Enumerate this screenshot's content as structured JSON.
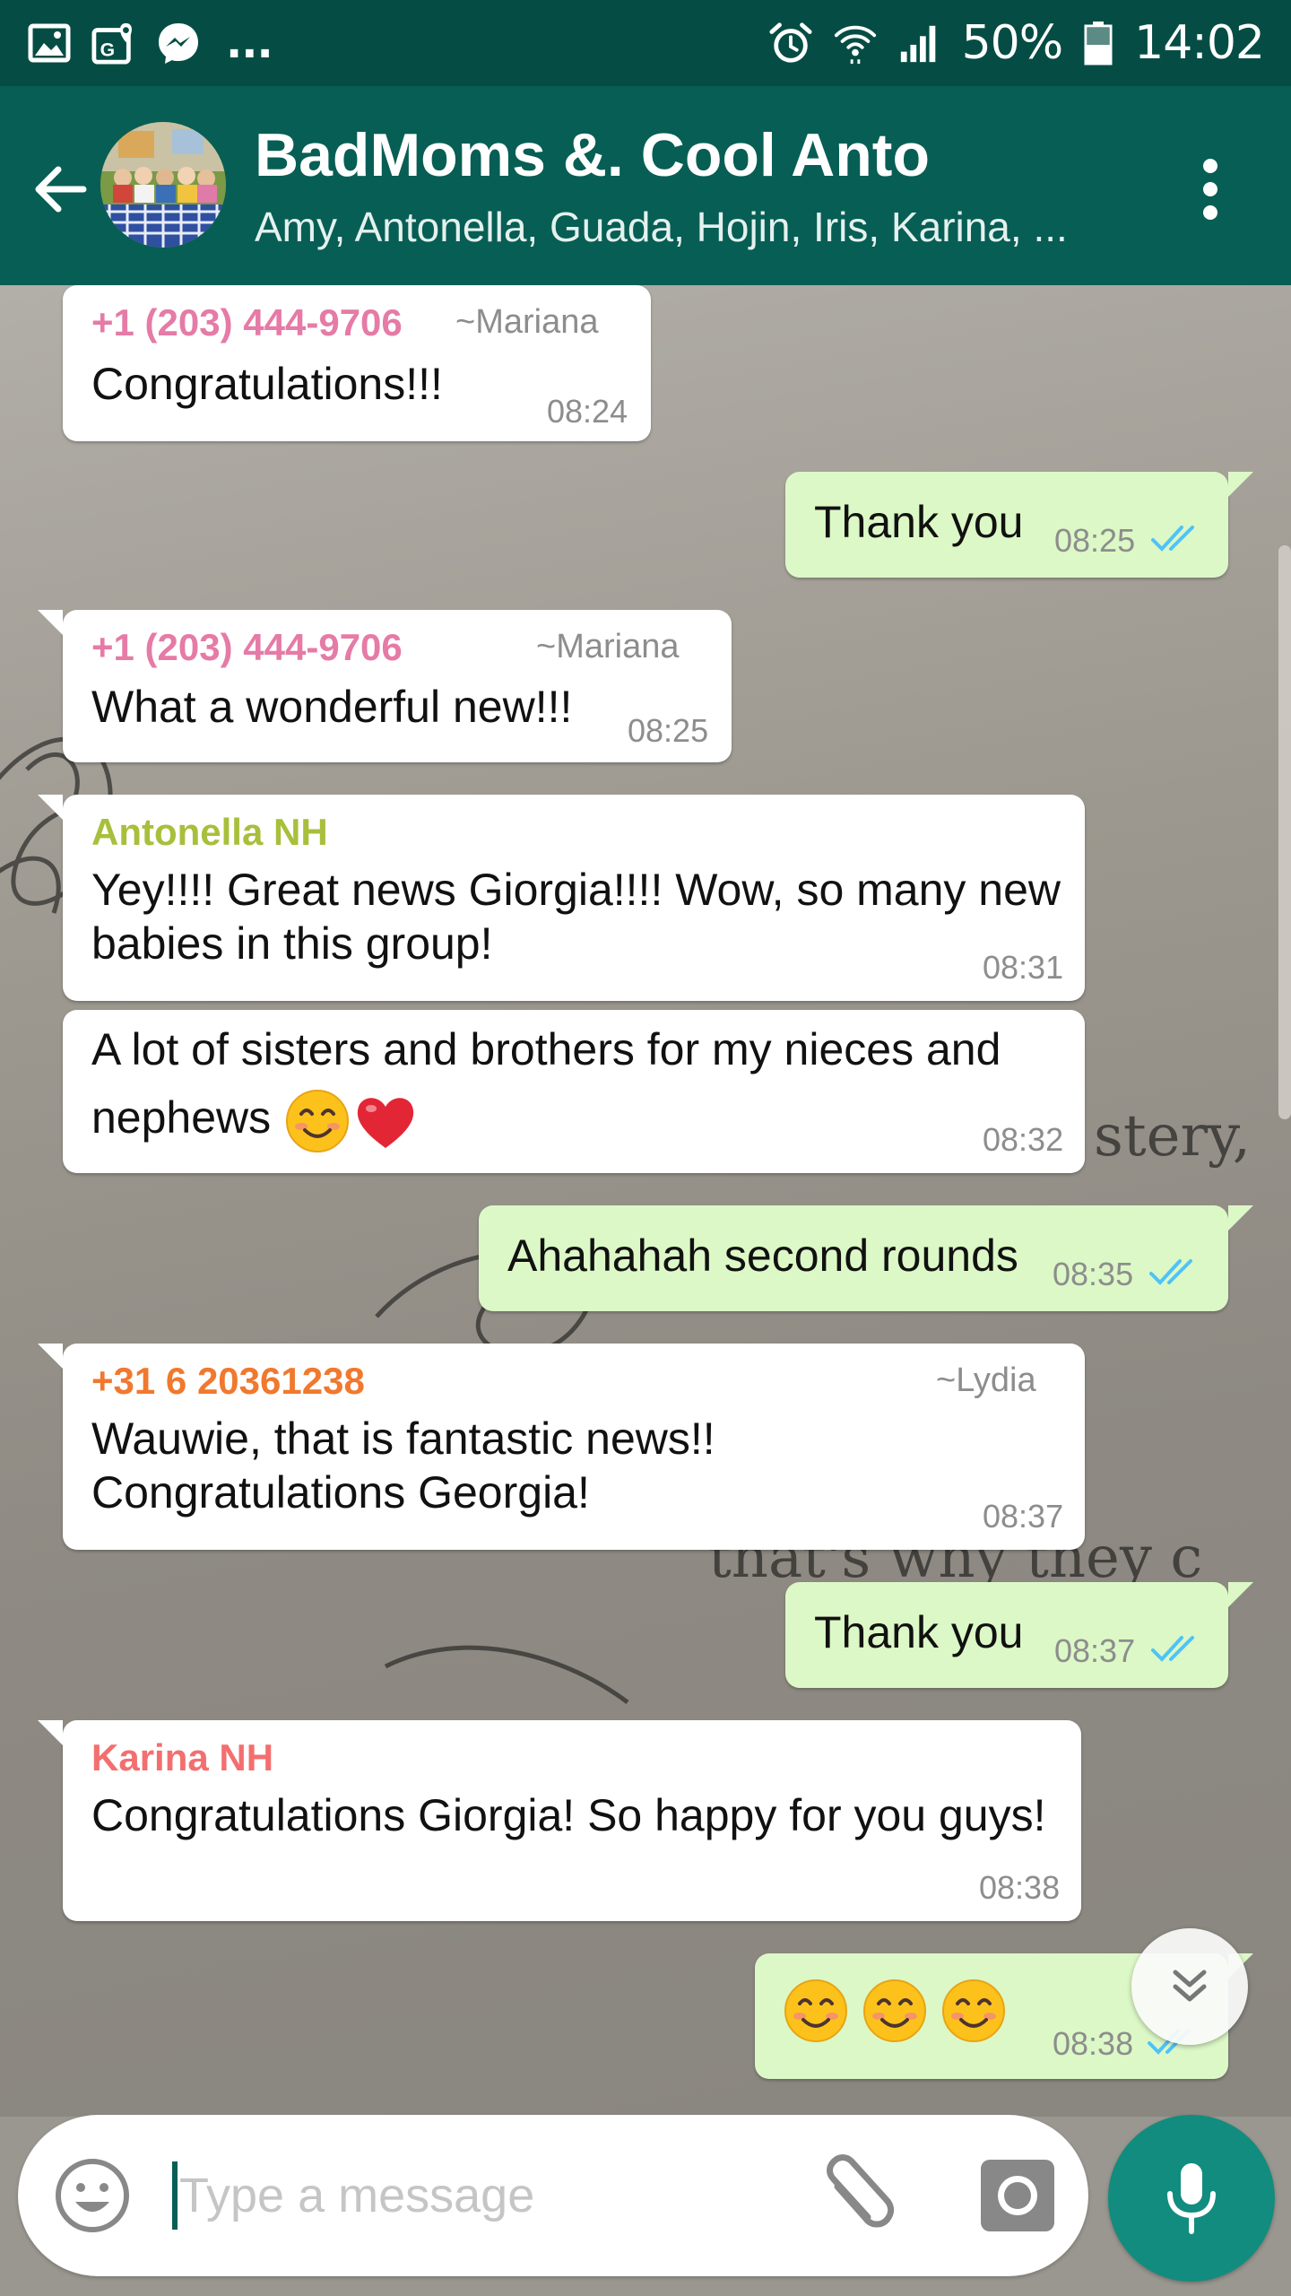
{
  "status_bar": {
    "battery": "50%",
    "time": "14:02",
    "notification_overflow": "...",
    "icons": [
      "gallery-icon",
      "maps-icon",
      "messenger-icon",
      "alarm-icon",
      "wifi-icon",
      "signal-icon",
      "battery-icon"
    ]
  },
  "header": {
    "title": "BadMoms &. Cool Anto",
    "members": "Amy, Antonella, Guada, Hojin, Iris, Karina, ..."
  },
  "colors": {
    "header": "#075e54",
    "status_bar": "#054d44",
    "incoming_bubble": "#ffffff",
    "outgoing_bubble": "#dcf8c6",
    "read_ticks": "#4fc3f7",
    "accent": "#128c7e"
  },
  "messages": [
    {
      "id": "m1",
      "direction": "in",
      "sender": "+1 (203) 444-9706",
      "alias": "~Mariana",
      "sender_color": "#e57ba6",
      "text": "Congratulations!!!",
      "time": "08:24"
    },
    {
      "id": "m2",
      "direction": "out",
      "text": "Thank you",
      "time": "08:25",
      "status": "read"
    },
    {
      "id": "m3",
      "direction": "in",
      "sender": "+1 (203) 444-9706",
      "alias": "~Mariana",
      "sender_color": "#e57ba6",
      "text": "What a wonderful new!!!",
      "time": "08:25"
    },
    {
      "id": "m4",
      "direction": "in",
      "sender": "Antonella NH",
      "sender_color": "#a8bf3c",
      "lines": [
        "Yey!!!! Great news Giorgia!!!! Wow, so many new",
        "babies in this group!"
      ],
      "time": "08:31"
    },
    {
      "id": "m5",
      "direction": "in",
      "lines": [
        "A lot of sisters and brothers for my nieces and",
        "nephews"
      ],
      "emojis": [
        "smiling-face-emoji",
        "red-heart-emoji"
      ],
      "time": "08:32"
    },
    {
      "id": "m6",
      "direction": "out",
      "text": "Ahahahah second rounds",
      "time": "08:35",
      "status": "read"
    },
    {
      "id": "m7",
      "direction": "in",
      "sender": "+31 6 20361238",
      "alias": "~Lydia",
      "sender_color": "#f0792e",
      "lines": [
        "Wauwie, that is fantastic news!!",
        "Congratulations Georgia!"
      ],
      "time": "08:37"
    },
    {
      "id": "m8",
      "direction": "out",
      "text": "Thank you",
      "time": "08:37",
      "status": "read"
    },
    {
      "id": "m9",
      "direction": "in",
      "sender": "Karina NH",
      "sender_color": "#f36f6f",
      "text": "Congratulations Giorgia! So happy for you guys!",
      "time": "08:38"
    },
    {
      "id": "m10",
      "direction": "out",
      "emojis": [
        "smiling-face-emoji",
        "smiling-face-emoji",
        "smiling-face-emoji"
      ],
      "time": "08:38",
      "status": "read"
    }
  ],
  "input": {
    "placeholder": "Type a message",
    "value": ""
  }
}
